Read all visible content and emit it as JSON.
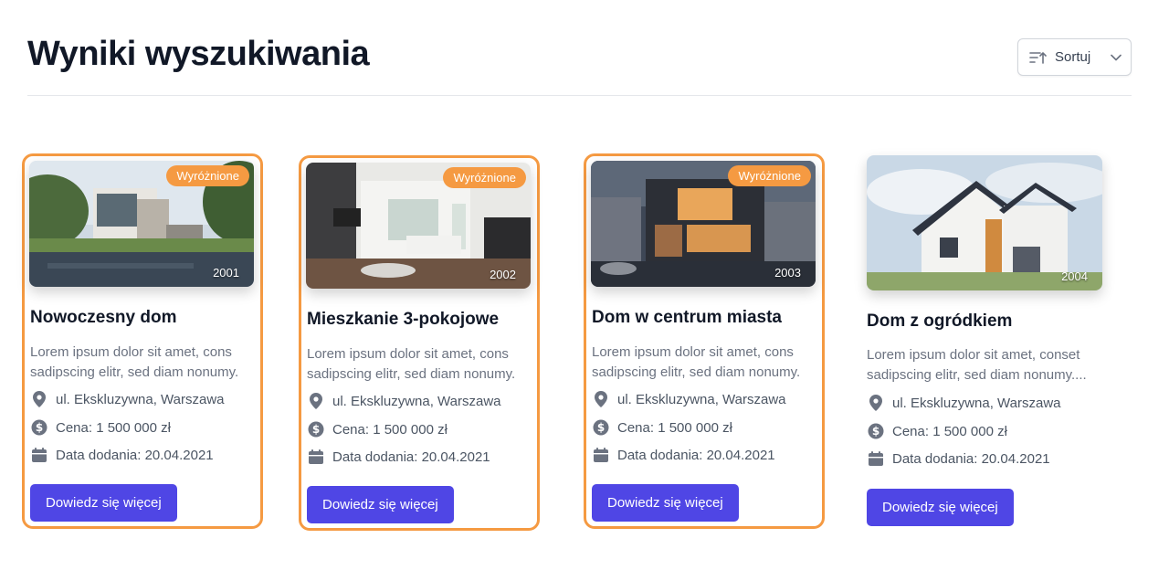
{
  "header": {
    "title": "Wyniki wyszukiwania",
    "sort_label": "Sortuj"
  },
  "colors": {
    "accent": "#4f46e5",
    "featured": "#f59a42"
  },
  "cards": [
    {
      "featured": true,
      "badge": "Wyróżnione",
      "image_number": "2001",
      "title": "Nowoczesny dom",
      "description": "Lorem ipsum dolor sit amet, cons sadipscing elitr, sed diam nonumy.",
      "address": "ul. Ekskluzywna, Warszawa",
      "price": "Cena: 1 500 000 zł",
      "date": "Data dodania: 20.04.2021",
      "button": "Dowiedz się więcej"
    },
    {
      "featured": true,
      "badge": "Wyróżnione",
      "image_number": "2002",
      "title": "Mieszkanie 3-pokojowe",
      "description": "Lorem ipsum dolor sit amet, cons sadipscing elitr, sed diam nonumy.",
      "address": "ul. Ekskluzywna, Warszawa",
      "price": "Cena: 1 500 000 zł",
      "date": "Data dodania: 20.04.2021",
      "button": "Dowiedz się więcej"
    },
    {
      "featured": true,
      "badge": "Wyróżnione",
      "image_number": "2003",
      "title": "Dom w centrum miasta",
      "description": "Lorem ipsum dolor sit amet, cons sadipscing elitr, sed diam nonumy.",
      "address": "ul. Ekskluzywna, Warszawa",
      "price": "Cena: 1 500 000 zł",
      "date": "Data dodania: 20.04.2021",
      "button": "Dowiedz się więcej"
    },
    {
      "featured": false,
      "image_number": "2004",
      "title": "Dom z ogródkiem",
      "description": "Lorem ipsum dolor sit amet, conset sadipscing elitr, sed diam nonumy....",
      "address": "ul. Ekskluzywna, Warszawa",
      "price": "Cena: 1 500 000 zł",
      "date": "Data dodania: 20.04.2021",
      "button": "Dowiedz się więcej"
    }
  ]
}
